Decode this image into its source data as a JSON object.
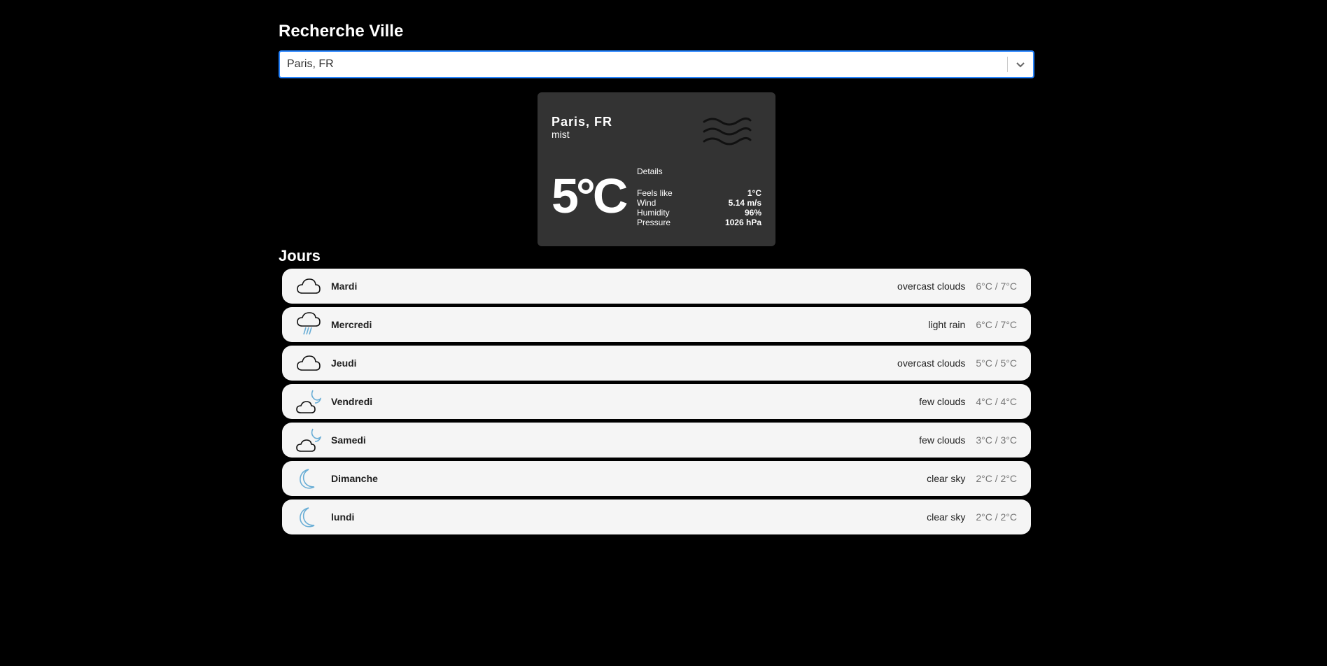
{
  "search": {
    "title": "Recherche Ville",
    "selected_value": "Paris, FR",
    "dropdown_icon": "chevron-down-icon"
  },
  "current": {
    "city": "Paris, FR",
    "description": "mist",
    "icon": "mist-icon",
    "temperature": "5°C",
    "details_title": "Details",
    "details": [
      {
        "label": "Feels like",
        "value": "1°C"
      },
      {
        "label": "Wind",
        "value": "5.14 m/s"
      },
      {
        "label": "Humidity",
        "value": "96%"
      },
      {
        "label": "Pressure",
        "value": "1026 hPa"
      }
    ]
  },
  "forecast": {
    "title": "Jours",
    "days": [
      {
        "name": "Mardi",
        "icon": "overcast-clouds-icon",
        "description": "overcast clouds",
        "temp": "6°C / 7°C"
      },
      {
        "name": "Mercredi",
        "icon": "light-rain-icon",
        "description": "light rain",
        "temp": "6°C / 7°C"
      },
      {
        "name": "Jeudi",
        "icon": "overcast-clouds-icon",
        "description": "overcast clouds",
        "temp": "5°C / 5°C"
      },
      {
        "name": "Vendredi",
        "icon": "few-clouds-night-icon",
        "description": "few clouds",
        "temp": "4°C / 4°C"
      },
      {
        "name": "Samedi",
        "icon": "few-clouds-night-icon",
        "description": "few clouds",
        "temp": "3°C / 3°C"
      },
      {
        "name": "Dimanche",
        "icon": "clear-sky-night-icon",
        "description": "clear sky",
        "temp": "2°C / 2°C"
      },
      {
        "name": "lundi",
        "icon": "clear-sky-night-icon",
        "description": "clear sky",
        "temp": "2°C / 2°C"
      }
    ]
  },
  "colors": {
    "background": "#000000",
    "card": "#333333",
    "row": "#f5f5f5",
    "select_focus": "#2684ff",
    "icon_blue": "#6aaed6"
  }
}
